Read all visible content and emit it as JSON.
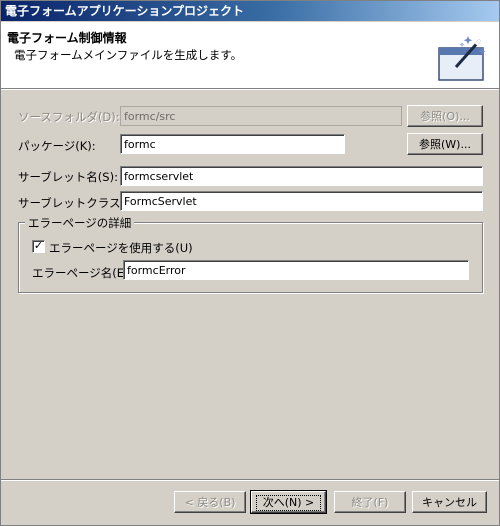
{
  "window": {
    "title": "電子フォームアプリケーションプロジェクト"
  },
  "banner": {
    "title": "電子フォーム制御情報",
    "description": "電子フォームメインファイルを生成します。"
  },
  "form": {
    "source_folder": {
      "label": "ソースフォルダ(D):",
      "value": "formc/src",
      "browse": "参照(O)..."
    },
    "package": {
      "label": "パッケージ(K):",
      "value": "formc",
      "browse": "参照(W)..."
    },
    "servlet_name": {
      "label": "サーブレット名(S):",
      "value": "formcservlet"
    },
    "servlet_class": {
      "label": "サーブレットクラス(C):",
      "value": "FormcServlet"
    }
  },
  "error_page": {
    "group_title": "エラーページの詳細",
    "use_checkbox_label": "エラーページを使用する(U)",
    "use_checked": true,
    "check_mark": "✓",
    "name_label": "エラーページ名(E):",
    "name_value": "formcError"
  },
  "buttons": {
    "back": "< 戻る(B)",
    "next": "次へ(N) >",
    "finish": "終了(F)",
    "cancel": "キャンセル"
  },
  "colors": {
    "title_bar_start": "#0a246a",
    "title_bar_end": "#a6caf0",
    "face": "#d4d0c8"
  }
}
